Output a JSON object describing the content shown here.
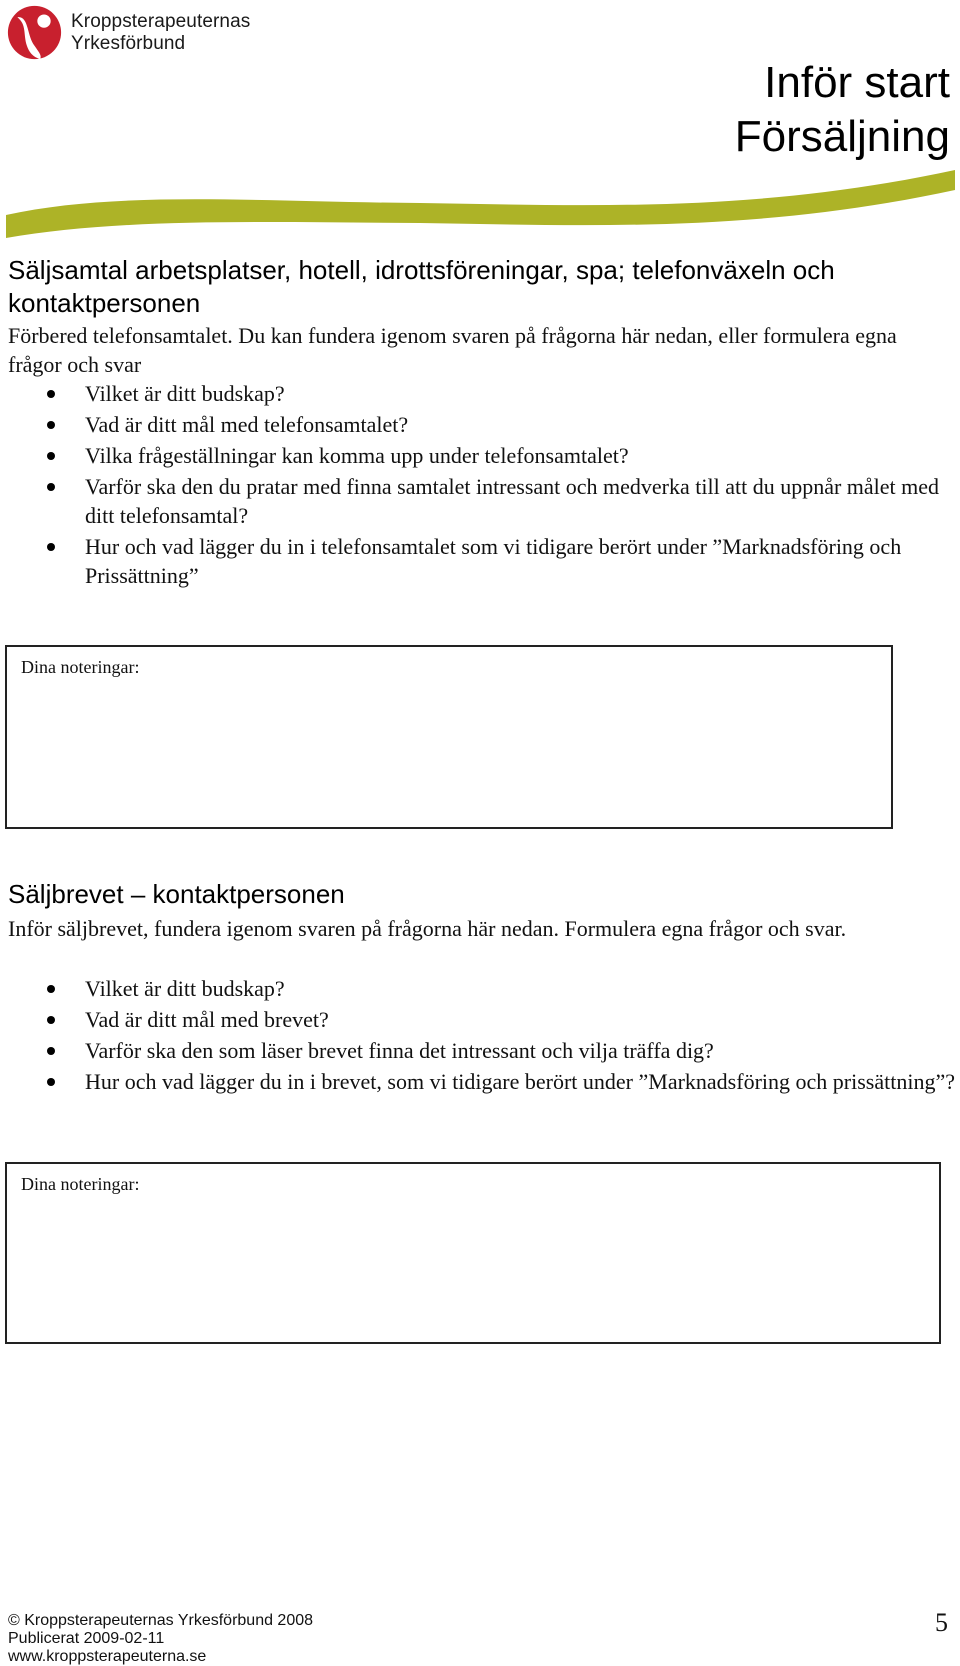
{
  "header": {
    "logo_line1": "Kroppsterapeuternas",
    "logo_line2": "Yrkesförbund",
    "title_line1": "Inför start",
    "title_line2": "Försäljning"
  },
  "colors": {
    "logo_red": "#c8202e",
    "wave_green": "#adb327"
  },
  "section1": {
    "heading": "Säljsamtal arbetsplatser, hotell, idrottsföreningar, spa; telefonväxeln och kontaktpersonen",
    "intro": "Förbered telefonsamtalet. Du kan fundera igenom svaren på frågorna här nedan, eller formulera egna frågor och svar",
    "bullets": [
      "Vilket är ditt budskap?",
      "Vad är ditt mål med telefonsamtalet?",
      "Vilka frågeställningar kan komma upp under telefonsamtalet?",
      "Varför ska den du pratar med finna samtalet intressant och medverka till att du uppnår målet med ditt telefonsamtal?",
      "Hur och vad lägger du in i telefonsamtalet som vi tidigare berört under ”Marknadsföring och Prissättning”"
    ],
    "notes_label": "Dina noteringar:",
    "notes_value": ""
  },
  "section2": {
    "heading": "Säljbrevet – kontaktpersonen",
    "intro": "Inför säljbrevet, fundera igenom svaren på frågorna här nedan. Formulera egna frågor och svar.",
    "bullets": [
      "Vilket är ditt budskap?",
      "Vad är ditt mål med brevet?",
      "Varför ska den som läser brevet finna det intressant och vilja träffa dig?",
      "Hur och vad lägger du in i brevet, som vi tidigare berört under ”Marknadsföring och prissättning”?"
    ],
    "notes_label": "Dina noteringar:",
    "notes_value": ""
  },
  "footer": {
    "copyright": "© Kroppsterapeuternas Yrkesförbund 2008",
    "published": "Publicerat 2009-02-11",
    "website": "www.kroppsterapeuterna.se",
    "page_number": "5"
  }
}
